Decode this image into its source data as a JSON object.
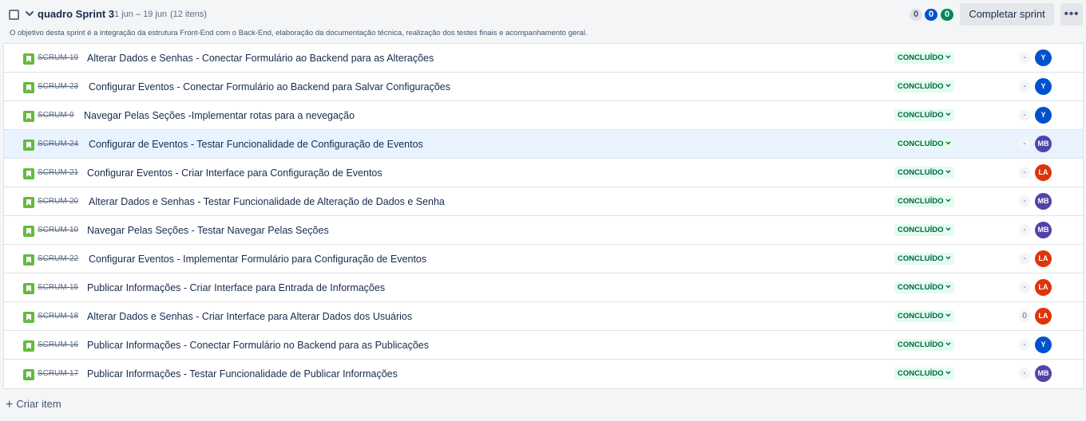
{
  "sprint": {
    "name": "quadro Sprint 3",
    "dates": "1 jun – 19 jun",
    "item_count": "(12 itens)",
    "goal": "O objetivo desta sprint é a integração da estrutura Front-End com o Back-End, elaboração da documentação técnica, realização dos testes finais e acompanhamento geral.",
    "counts": {
      "todo": "0",
      "in_progress": "0",
      "done": "0"
    },
    "complete_label": "Completar sprint",
    "more_label": "•••"
  },
  "colors": {
    "story": "#63ba3c",
    "status_bg": "#e3fcef",
    "status_text": "#006644",
    "avatar_Y": "#0052cc",
    "avatar_MB": "#5243aa",
    "avatar_LA": "#de350b"
  },
  "issues": [
    {
      "key": "SCRUM-19",
      "summary": "Alterar Dados e Senhas - Conectar Formulário ao Backend para as Alterações",
      "status": "CONCLUÍDO",
      "estimate": "-",
      "assignee": "Y"
    },
    {
      "key": "SCRUM-23",
      "summary": "Configurar Eventos - Conectar Formulário ao Backend para Salvar Configurações",
      "status": "CONCLUÍDO",
      "estimate": "-",
      "assignee": "Y"
    },
    {
      "key": "SCRUM-9",
      "summary": "Navegar Pelas Seções -Implementar rotas para a nevegação",
      "status": "CONCLUÍDO",
      "estimate": "-",
      "assignee": "Y"
    },
    {
      "key": "SCRUM-24",
      "summary": "Configurar de Eventos - Testar Funcionalidade de Configuração de Eventos",
      "status": "CONCLUÍDO",
      "estimate": "-",
      "assignee": "MB"
    },
    {
      "key": "SCRUM-21",
      "summary": "Configurar Eventos - Criar Interface para Configuração de Eventos",
      "status": "CONCLUÍDO",
      "estimate": "-",
      "assignee": "LA"
    },
    {
      "key": "SCRUM-20",
      "summary": "Alterar Dados e Senhas - Testar Funcionalidade de Alteração de Dados e Senha",
      "status": "CONCLUÍDO",
      "estimate": "-",
      "assignee": "MB"
    },
    {
      "key": "SCRUM-10",
      "summary": "Navegar Pelas Seções - Testar Navegar Pelas Seções",
      "status": "CONCLUÍDO",
      "estimate": "-",
      "assignee": "MB"
    },
    {
      "key": "SCRUM-22",
      "summary": "Configurar Eventos - Implementar Formulário para Configuração de Eventos",
      "status": "CONCLUÍDO",
      "estimate": "-",
      "assignee": "LA"
    },
    {
      "key": "SCRUM-15",
      "summary": "Publicar Informações - Criar Interface para Entrada de Informações",
      "status": "CONCLUÍDO",
      "estimate": "-",
      "assignee": "LA"
    },
    {
      "key": "SCRUM-18",
      "summary": "Alterar Dados e Senhas - Criar Interface para Alterar Dados dos Usuários",
      "status": "CONCLUÍDO",
      "estimate": "0",
      "assignee": "LA"
    },
    {
      "key": "SCRUM-16",
      "summary": "Publicar Informações - Conectar Formulário no Backend para as Publicações",
      "status": "CONCLUÍDO",
      "estimate": "-",
      "assignee": "Y"
    },
    {
      "key": "SCRUM-17",
      "summary": "Publicar Informações - Testar Funcionalidade de Publicar Informações",
      "status": "CONCLUÍDO",
      "estimate": "-",
      "assignee": "MB"
    }
  ],
  "create_label": "Criar item"
}
